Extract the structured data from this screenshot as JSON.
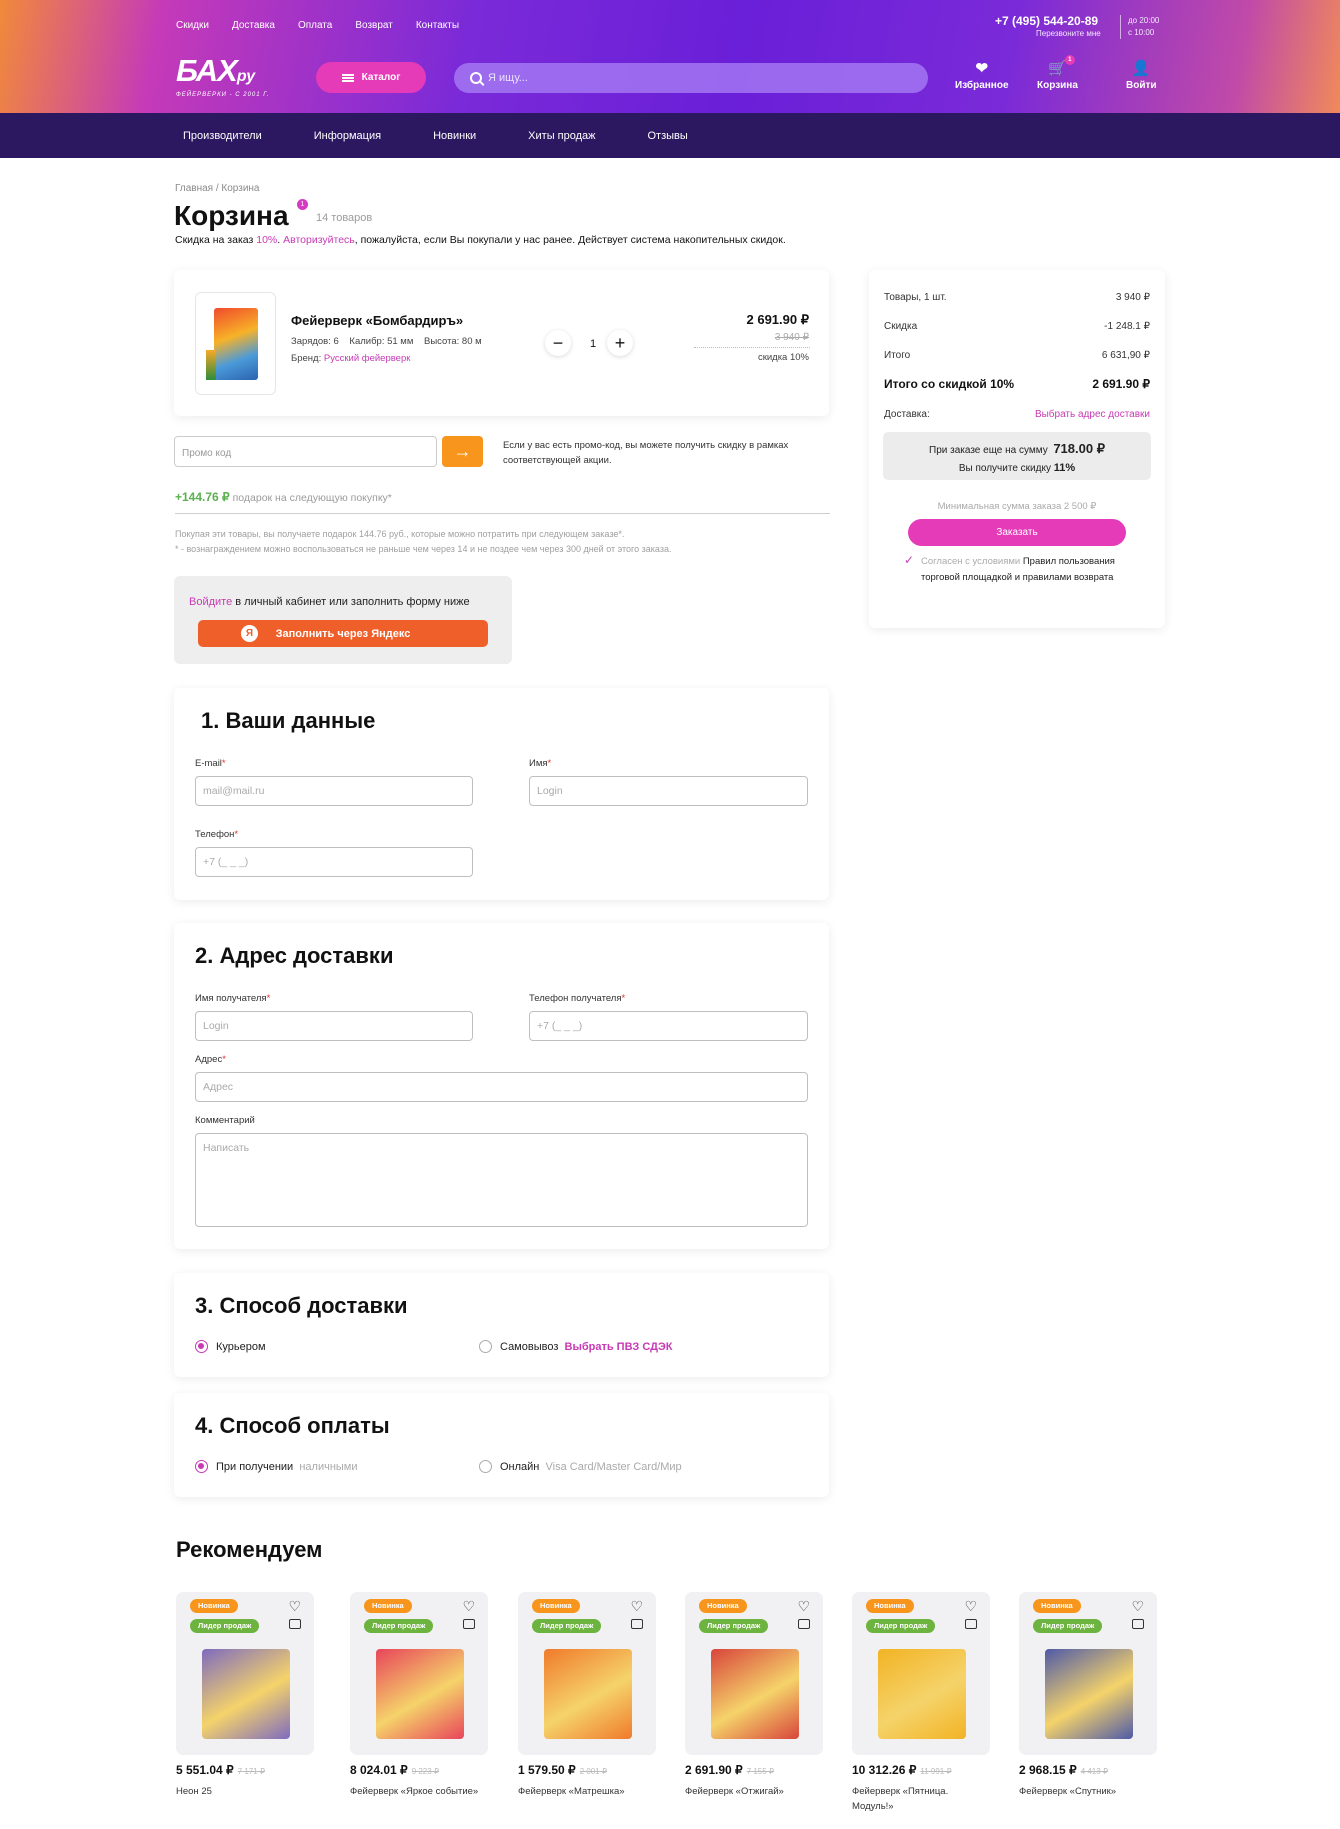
{
  "header": {
    "topnav": [
      "Скидки",
      "Доставка",
      "Оплата",
      "Возврат",
      "Контакты"
    ],
    "phone": "+7 (495) 544-20-89",
    "callback": "Перезвоните мне",
    "hours_to": "до 20:00",
    "hours_from": "с 10:00",
    "logo_main": "БАХ",
    "logo_suffix": "ру",
    "logo_sub": "ФЕЙЕРВЕРКИ - С 2001 Г.",
    "catalog_label": "Каталог",
    "search_placeholder": "Я ищу...",
    "favorites_label": "Избранное",
    "cart_label": "Корзина",
    "cart_count": "1",
    "login_label": "Войти"
  },
  "subnav": [
    "Производители",
    "Информация",
    "Новинки",
    "Хиты продаж",
    "Отзывы"
  ],
  "breadcrumb": {
    "home": "Главная",
    "sep": "/",
    "current": "Корзина"
  },
  "page": {
    "title": "Корзина",
    "title_badge": "1",
    "items_count": "14 товаров",
    "notice_start": "Скидка на заказ ",
    "notice_discount": "10%",
    "notice_dot": ". ",
    "notice_link": "Авторизуйтесь",
    "notice_end": ", пожалуйста, если Вы покупали у нас ранее. Действует система накопительных скидок."
  },
  "cart_item": {
    "name": "Фейерверк «Бомбардиръ»",
    "specs": [
      "Зарядов: 6",
      "Калибр: 51 мм",
      "Высота: 80 м"
    ],
    "brand_label": "Бренд: ",
    "brand": "Русский фейерверк",
    "qty": "1",
    "minus": "−",
    "plus": "+",
    "price": "2 691.90 ₽",
    "old_price": "3 940 ₽",
    "discount": "скидка 10%"
  },
  "promo": {
    "placeholder": "Промо код",
    "arrow": "→",
    "note": "Если у вас есть промо-код, вы можете получить скидку в рамках соответствующей акции."
  },
  "gift": {
    "amount": "+144.76 ₽",
    "label": "подарок на следующую покупку*",
    "note1": "Покупая эти товары, вы получаете подарок 144.76 руб., которые можно потратить при следующем заказе*.",
    "note2": "* - вознаграждением можно воспользоваться не раньше чем через 14 и не поздее чем через 300 дней от этого заказа."
  },
  "login_box": {
    "link": "Войдите",
    "text": " в личный кабинет или заполнить форму ниже",
    "yandex_letter": "Я",
    "yandex_btn": "Заполнить через Яндекс"
  },
  "form1": {
    "title": "1. Ваши данные",
    "email_label": "E-mail",
    "email_placeholder": "mail@mail.ru",
    "name_label": "Имя",
    "name_placeholder": "Login",
    "phone_label": "Телефон",
    "phone_placeholder": "+7 (_ _ _)",
    "required": "*"
  },
  "form2": {
    "title": "2. Адрес доставки",
    "recipient_label": "Имя получателя",
    "recipient_placeholder": "Login",
    "rphone_label": "Телефон получателя",
    "rphone_placeholder": "+7 (_ _ _)",
    "address_label": "Адрес",
    "address_placeholder": "Адрес",
    "comment_label": "Комментарий",
    "comment_placeholder": "Написать"
  },
  "delivery": {
    "title": "3. Способ доставки",
    "courier": "Курьером",
    "pickup": "Самовывоз",
    "pickup_link": "Выбрать ПВЗ СДЭК"
  },
  "payment": {
    "title": "4. Способ оплаты",
    "on_receipt": "При получении",
    "on_receipt_note": "наличными",
    "online": "Онлайн",
    "online_note": "Visa Card/Master Card/Мир"
  },
  "summary": {
    "goods_label": "Товары, 1 шт.",
    "goods_value": "3 940 ₽",
    "discount_label": "Скидка",
    "discount_value": "-1 248.1 ₽",
    "total_label": "Итого",
    "total_value": "6 631,90 ₽",
    "final_label": "Итого со скидкой 10%",
    "final_value": "2 691.90 ₽",
    "delivery_label": "Доставка:",
    "delivery_link": "Выбрать адрес доставки",
    "banner_line1": "При заказе еще на сумму",
    "banner_amount": "718.00 ₽",
    "banner_line2": "Вы получите скидку",
    "banner_pct": "11%",
    "min_sum": "Минимальная сумма заказа 2 500 ₽",
    "order_btn": "Заказать",
    "agree_text": "Согласен с условиями",
    "agree_link": "Правил пользования торговой площадкой и правилами возврата",
    "check": "✓"
  },
  "recommend": {
    "title": "Рекомендуем",
    "tag_new": "Новинка",
    "tag_hit": "Лидер продаж",
    "items": [
      {
        "price": "5 551.04 ₽",
        "old": "7 171 ₽",
        "name": "Неон 25",
        "color": "#7e6bbf"
      },
      {
        "price": "8 024.01 ₽",
        "old": "9 223 ₽",
        "name": "Фейерверк «Яркое событие»",
        "color": "#e8455a"
      },
      {
        "price": "1 579.50 ₽",
        "old": "2 001 ₽",
        "name": "Фейерверк «Матрешка»",
        "color": "#f07a2c"
      },
      {
        "price": "2 691.90 ₽",
        "old": "7 155 ₽",
        "name": "Фейерверк «Отжигай»",
        "color": "#d8453b"
      },
      {
        "price": "10 312.26 ₽",
        "old": "11 991 ₽",
        "name": "Фейерверк «Пятница. Модуль!»",
        "color": "#f2b324"
      },
      {
        "price": "2 968.15 ₽",
        "old": "4 413 ₽",
        "name": "Фейерверк «Спутник»",
        "color": "#4f5aa8"
      }
    ]
  }
}
